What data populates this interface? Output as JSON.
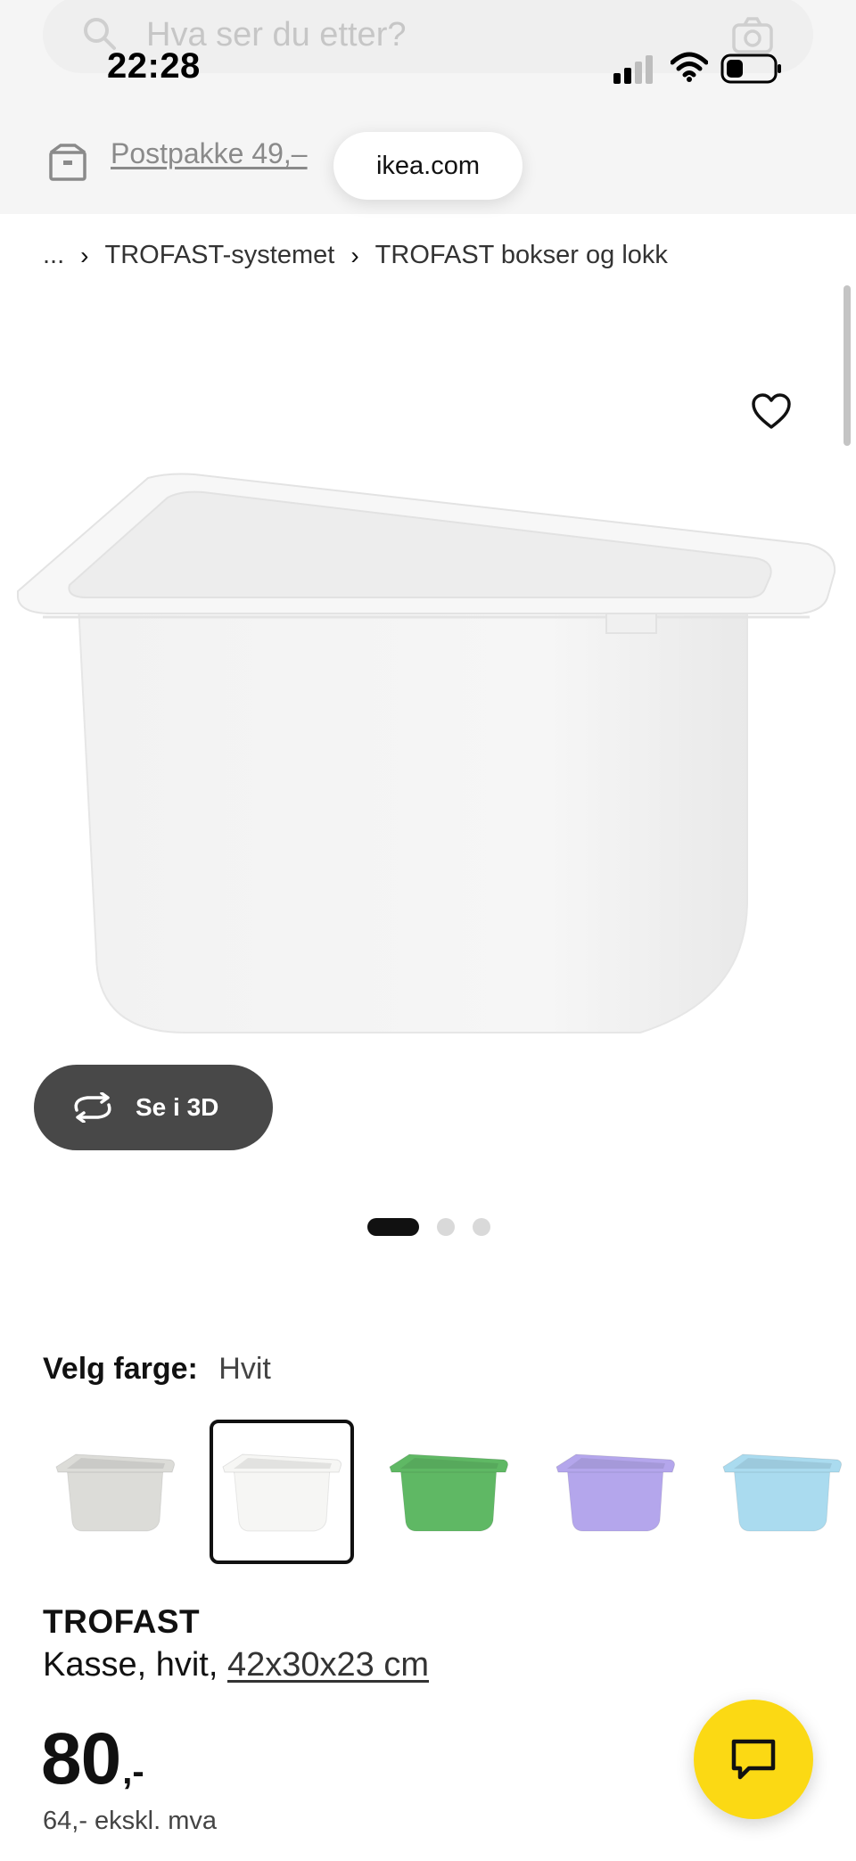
{
  "search": {
    "placeholder": "Hva ser du etter?"
  },
  "status_bar": {
    "time": "22:28"
  },
  "delivery": {
    "link_text": "Postpakke 49,–",
    "icon": "truck-icon"
  },
  "browser": {
    "url": "ikea.com"
  },
  "breadcrumb": {
    "items": [
      "...",
      "TROFAST-systemet",
      "TROFAST bokser og lokk"
    ]
  },
  "gallery": {
    "see_3d_label": "Se i 3D",
    "dots_total": 3,
    "active_dot": 1
  },
  "color": {
    "label": "Velg farge:",
    "selected": "Hvit",
    "swatches": [
      {
        "name": "grey",
        "fill": "#dcdcd8",
        "selected": false
      },
      {
        "name": "white",
        "fill": "#f6f6f4",
        "selected": true
      },
      {
        "name": "green",
        "fill": "#5fb864",
        "selected": false
      },
      {
        "name": "lilac",
        "fill": "#b4a6ec",
        "selected": false
      },
      {
        "name": "light-blue",
        "fill": "#aadbef",
        "selected": false
      }
    ]
  },
  "product": {
    "name": "TROFAST",
    "desc_prefix": "Kasse, hvit, ",
    "dimensions": "42x30x23 cm",
    "price_integer": "80",
    "price_suffix": ",-",
    "price_ex_vat": "64,- ekskl. mva"
  },
  "colors": {
    "accent_chat": "#fbd914",
    "dark_button": "#484848"
  }
}
